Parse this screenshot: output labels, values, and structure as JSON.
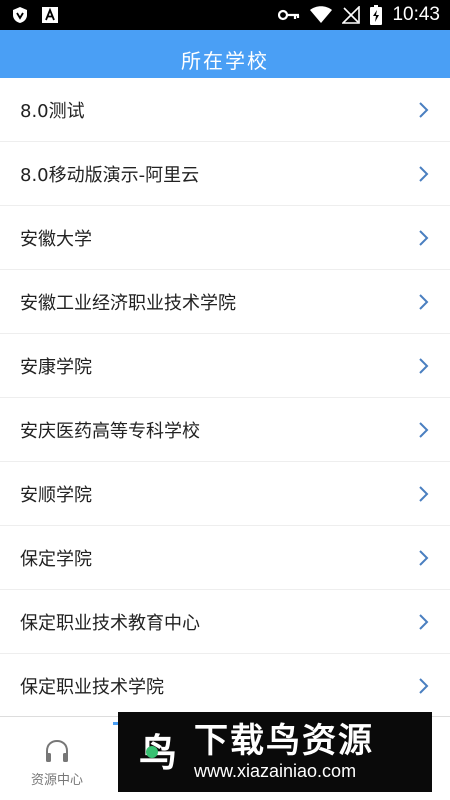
{
  "status_bar": {
    "time": "10:43",
    "icons": [
      "shield-icon",
      "font-a-icon",
      "key-icon",
      "wifi-icon",
      "no-signal-icon",
      "battery-charging-icon"
    ]
  },
  "header": {
    "title": "所在学校"
  },
  "schools": [
    {
      "name": "8.0测试"
    },
    {
      "name": "8.0移动版演示-阿里云"
    },
    {
      "name": "安徽大学"
    },
    {
      "name": "安徽工业经济职业技术学院"
    },
    {
      "name": "安康学院"
    },
    {
      "name": "安庆医药高等专科学校"
    },
    {
      "name": "安顺学院"
    },
    {
      "name": "保定学院"
    },
    {
      "name": "保定职业技术教育中心"
    },
    {
      "name": "保定职业技术学院"
    }
  ],
  "bottom_nav": {
    "tabs": [
      {
        "label": "资源中心",
        "icon": "headphones-icon"
      }
    ]
  },
  "watermark": {
    "logo_text": "鸟",
    "title": "下载鸟资源",
    "url": "www.xiazainiao.com"
  },
  "colors": {
    "accent": "#4a9ff5",
    "chevron": "#4a7fc0",
    "text": "#222222"
  }
}
